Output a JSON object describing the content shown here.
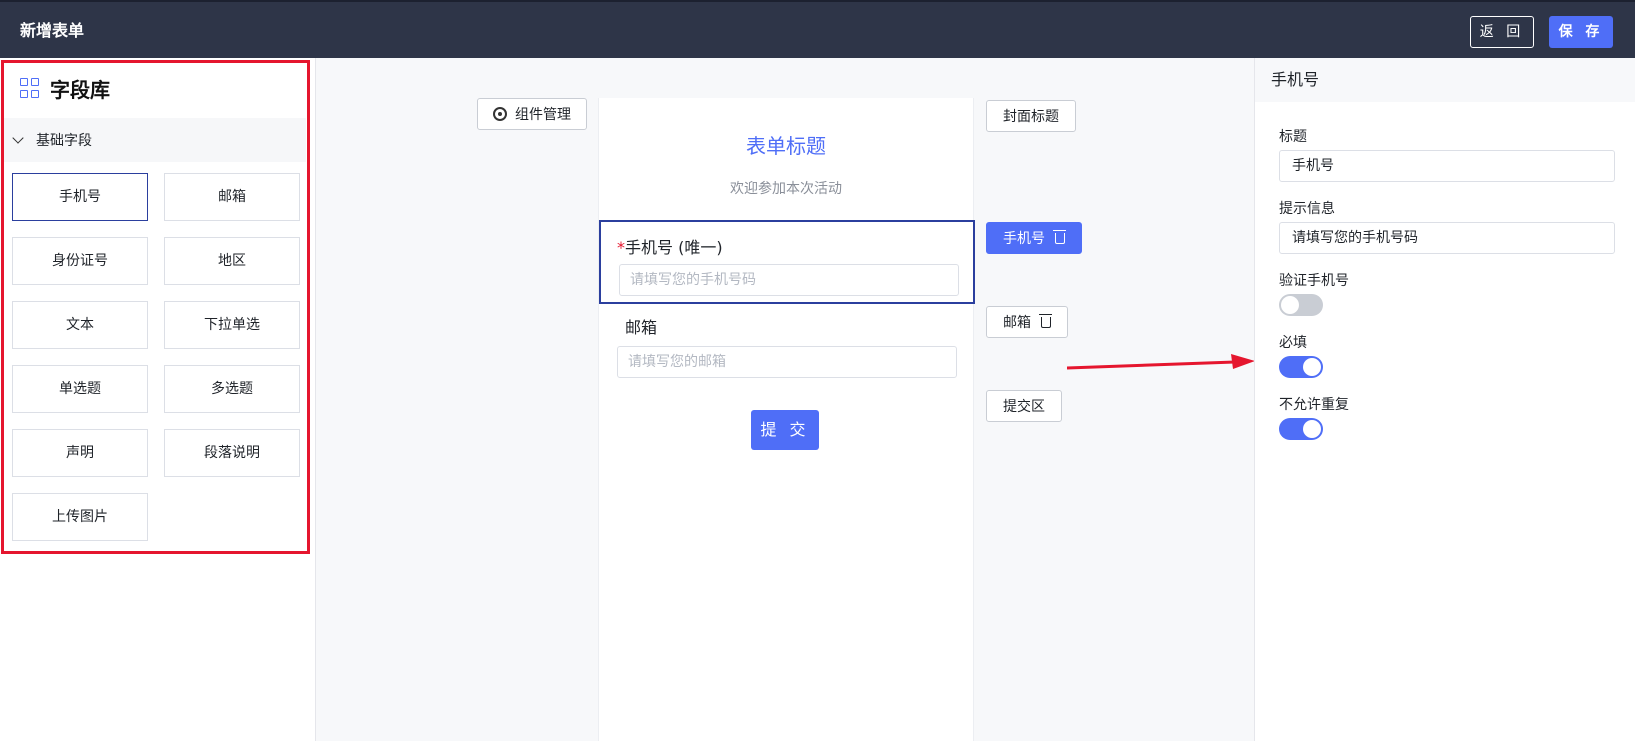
{
  "header": {
    "title": "新增表单",
    "back_label": "返 回",
    "save_label": "保 存"
  },
  "library": {
    "title": "字段库",
    "group_label": "基础字段",
    "fields": [
      "手机号",
      "邮箱",
      "身份证号",
      "地区",
      "文本",
      "下拉单选",
      "单选题",
      "多选题",
      "声明",
      "段落说明",
      "上传图片"
    ],
    "active_field": "手机号"
  },
  "canvas": {
    "component_manage_label": "组件管理",
    "form_title": "表单标题",
    "form_subtitle": "欢迎参加本次活动",
    "q1": {
      "required_mark": "*",
      "label": "手机号 (唯一)",
      "placeholder": "请填写您的手机号码"
    },
    "q2": {
      "label": "邮箱",
      "placeholder": "请填写您的邮箱"
    },
    "submit_label": "提 交",
    "side_tags": {
      "cover": "封面标题",
      "phone": "手机号",
      "email": "邮箱",
      "submit_area": "提交区"
    }
  },
  "properties": {
    "panel_title": "手机号",
    "title_label": "标题",
    "title_value": "手机号",
    "hint_label": "提示信息",
    "hint_value": "请填写您的手机号码",
    "verify_label": "验证手机号",
    "verify_on": false,
    "required_label": "必填",
    "required_on": true,
    "no_duplicate_label": "不允许重复",
    "no_duplicate_on": true
  },
  "colors": {
    "accent": "#4f6ef7",
    "header_bg": "#2e3548",
    "highlight_red": "#e5162e",
    "selection_border": "#2b3f9e"
  }
}
